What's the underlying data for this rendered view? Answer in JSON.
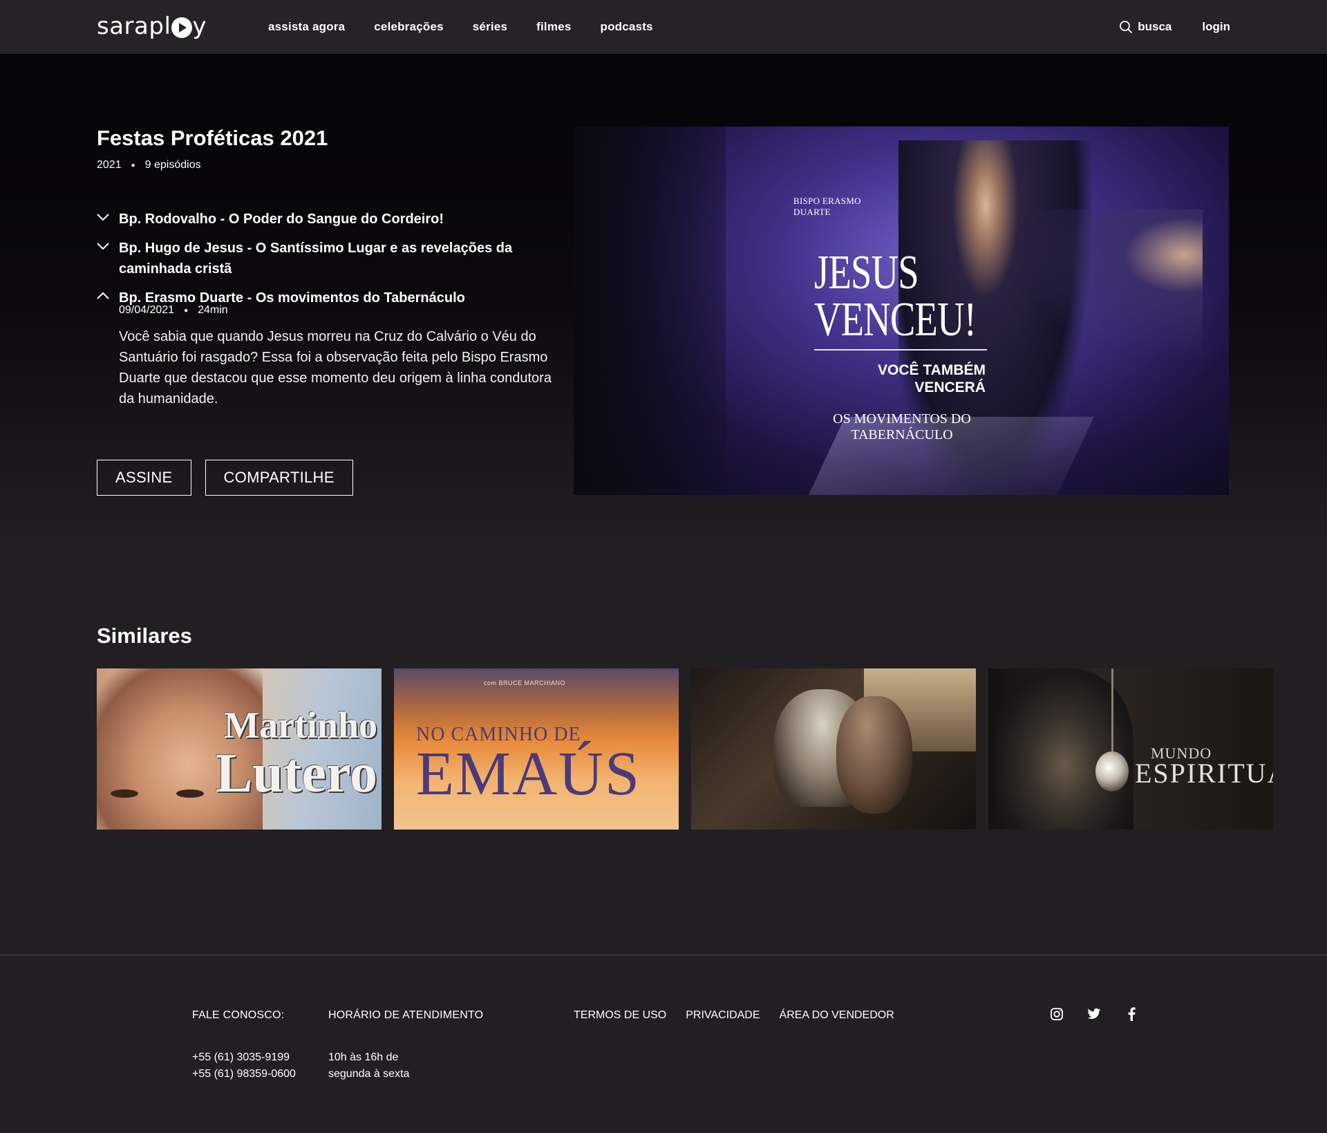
{
  "nav": {
    "logo": "saraplay",
    "links": [
      "assista agora",
      "celebrações",
      "séries",
      "filmes",
      "podcasts"
    ],
    "search_label": "busca",
    "login_label": "login"
  },
  "series": {
    "title": "Festas Proféticas 2021",
    "year": "2021",
    "episodes_count": "9 episódios"
  },
  "episodes": [
    {
      "title": "Bp. Rodovalho - O Poder do Sangue do Cordeiro!",
      "expanded": false
    },
    {
      "title": "Bp. Hugo de Jesus - O Santíssimo Lugar e as revelações da caminhada cristã",
      "expanded": false
    },
    {
      "title": "Bp. Erasmo Duarte - Os movimentos do Tabernáculo",
      "expanded": true,
      "date": "09/04/2021",
      "duration": "24min",
      "description": "Você sabia que quando Jesus morreu na Cruz do Calvário o Véu do Santuário foi rasgado? Essa foi a observação feita pelo Bispo Erasmo Duarte que destacou que esse momento deu origem à linha condutora da humanidade."
    }
  ],
  "actions": {
    "subscribe": "ASSINE",
    "share": "COMPARTILHE"
  },
  "poster": {
    "speaker_line1": "BISPO ERASMO",
    "speaker_line2": "DUARTE",
    "headline_line1": "JESUS",
    "headline_line2": "VENCEU!",
    "sub_line1": "VOCÊ TAMBÉM",
    "sub_line2": "VENCERÁ",
    "theme_line1": "OS MOVIMENTOS DO",
    "theme_line2": "TABERNÁCULO"
  },
  "similares": {
    "title": "Similares",
    "items": [
      {
        "line1": "Martinho",
        "line2": "Lutero"
      },
      {
        "small": "com BRUCE MARCHIANO",
        "line1": "NO CAMINHO DE",
        "line2": "EMAÚS"
      },
      {},
      {
        "line1": "MUNDO",
        "line2": "ESPIRITUAL"
      }
    ]
  },
  "footer": {
    "contact_heading": "FALE CONOSCO:",
    "phone1": "+55 (61) 3035-9199",
    "phone2": "+55 (61) 98359-0600",
    "hours_heading": "HORÁRIO DE ATENDIMENTO",
    "hours_line1": "10h às 16h de",
    "hours_line2": "segunda à sexta",
    "links": [
      "TERMOS DE USO",
      "PRIVACIDADE",
      "ÁREA DO VENDEDOR"
    ],
    "socials": [
      "instagram-icon",
      "twitter-icon",
      "facebook-icon"
    ]
  }
}
